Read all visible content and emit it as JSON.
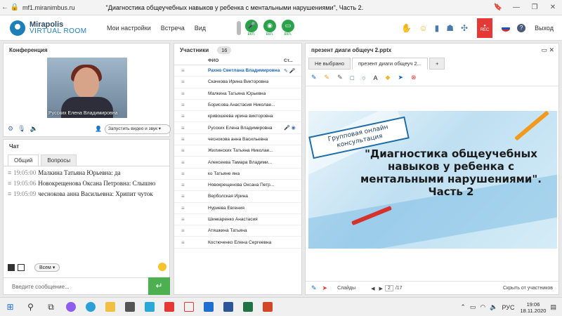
{
  "browser": {
    "url": "mf1.miranimbus.ru",
    "title": "\"Диагностика общеучебных навыков у ребенка с ментальными нарушениями\", Часть 2."
  },
  "header": {
    "logo_line1": "Mirapolis",
    "logo_line2": "VIRTUAL ROOM",
    "menu": [
      "Мои настройки",
      "Встреча",
      "Вид"
    ],
    "toggles": [
      "вкл.",
      "вкл.",
      "вкл."
    ],
    "rec_label": "REC",
    "exit_label": "Выход"
  },
  "conference": {
    "title": "Конференция",
    "video_name": "Русских Елена Владимировна",
    "start_video_label": "Запустить видео и звук"
  },
  "chat": {
    "title": "Чат",
    "tabs": [
      "Общий",
      "Вопросы"
    ],
    "messages": [
      {
        "time": "19:05:00",
        "author": "Малкина Татьяна  Юрьевна:",
        "text": "да"
      },
      {
        "time": "19:05:06",
        "author": "Новокрещенова  Оксана Петровна:",
        "text": "Слышно"
      },
      {
        "time": "19:05:09",
        "author": "чеснокова  анна Васильевна:",
        "text": "Хрипит чуток"
      }
    ],
    "recipient": "Всем",
    "input_placeholder": "Введите сообщение..."
  },
  "participants": {
    "title": "Участники",
    "count": "16",
    "col_name": "ФИО",
    "col_status": "Ст...",
    "rows": [
      "Рахно Светлана  Владимировна",
      "Скачкова  Ирина Викторовна",
      "Малкина Татьяна  Юрьевна",
      "Борисова  Анастасия Николае...",
      "кривошеева ирина викторовна",
      "Русских Елена Владимировна",
      "чеснокова  анна Васильевна",
      "Жилинских  Татьяна  Николае...",
      "Алексеева  Тамара  Владими...",
      "ко Татьяне яна",
      "Новокрещенова  Оксана Петр...",
      "Верболская Ирина",
      "Нуриева Евгения",
      "Шинкаренко  Анастасия",
      "Атяшкина Татьяна",
      "Костюченко  Елена Сергеевна"
    ]
  },
  "presentation": {
    "title": "презент диаги общеуч 2.pptx",
    "tabs": [
      "Не выбрано",
      "презент диаги общеуч 2..."
    ],
    "add_tab": "+",
    "slide_badge": "Групповая онлайн консультация",
    "slide_title": "\"Диагностика общеучебных навыков у ребенка с ментальными нарушениями\". Часть 2",
    "slides_label": "Слайды",
    "page_current": "2",
    "page_total": "/17",
    "hide_label": "Скрыть от участников"
  },
  "taskbar": {
    "lang": "РУС",
    "time": "19:06",
    "date": "18.11.2020"
  }
}
